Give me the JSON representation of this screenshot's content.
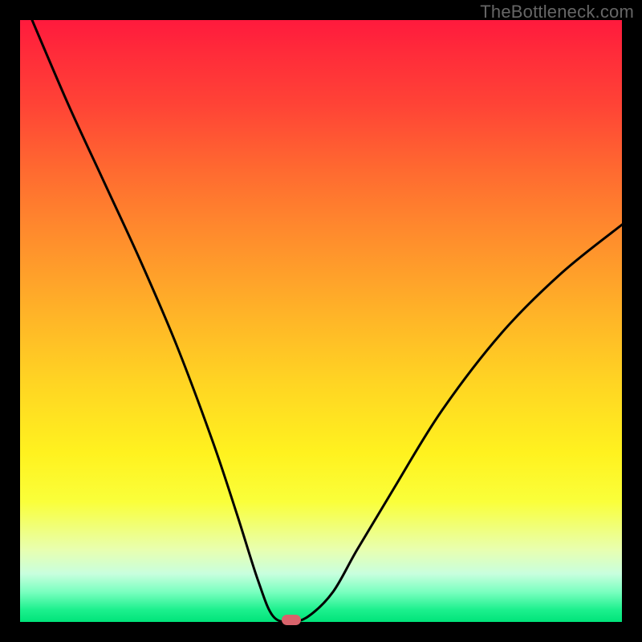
{
  "watermark": "TheBottleneck.com",
  "chart_data": {
    "type": "line",
    "title": "",
    "xlabel": "",
    "ylabel": "",
    "xlim": [
      0,
      100
    ],
    "ylim": [
      0,
      100
    ],
    "grid": false,
    "series": [
      {
        "name": "curve",
        "x": [
          2,
          8,
          14,
          20,
          26,
          32,
          36,
          39.5,
          42,
          45,
          48,
          52,
          56,
          62,
          70,
          80,
          90,
          100
        ],
        "values": [
          100,
          86,
          73,
          60,
          46,
          30,
          18,
          7,
          1,
          0,
          1,
          5,
          12,
          22,
          35,
          48,
          58,
          66
        ]
      }
    ],
    "marker": {
      "x": 45,
      "y": 0
    },
    "line_color": "#000000",
    "gradient_stops": [
      {
        "pos": 0,
        "color": "#ff1a3d"
      },
      {
        "pos": 0.5,
        "color": "#ffd423"
      },
      {
        "pos": 0.9,
        "color": "#e8ffb0"
      },
      {
        "pos": 1.0,
        "color": "#00e37a"
      }
    ]
  }
}
